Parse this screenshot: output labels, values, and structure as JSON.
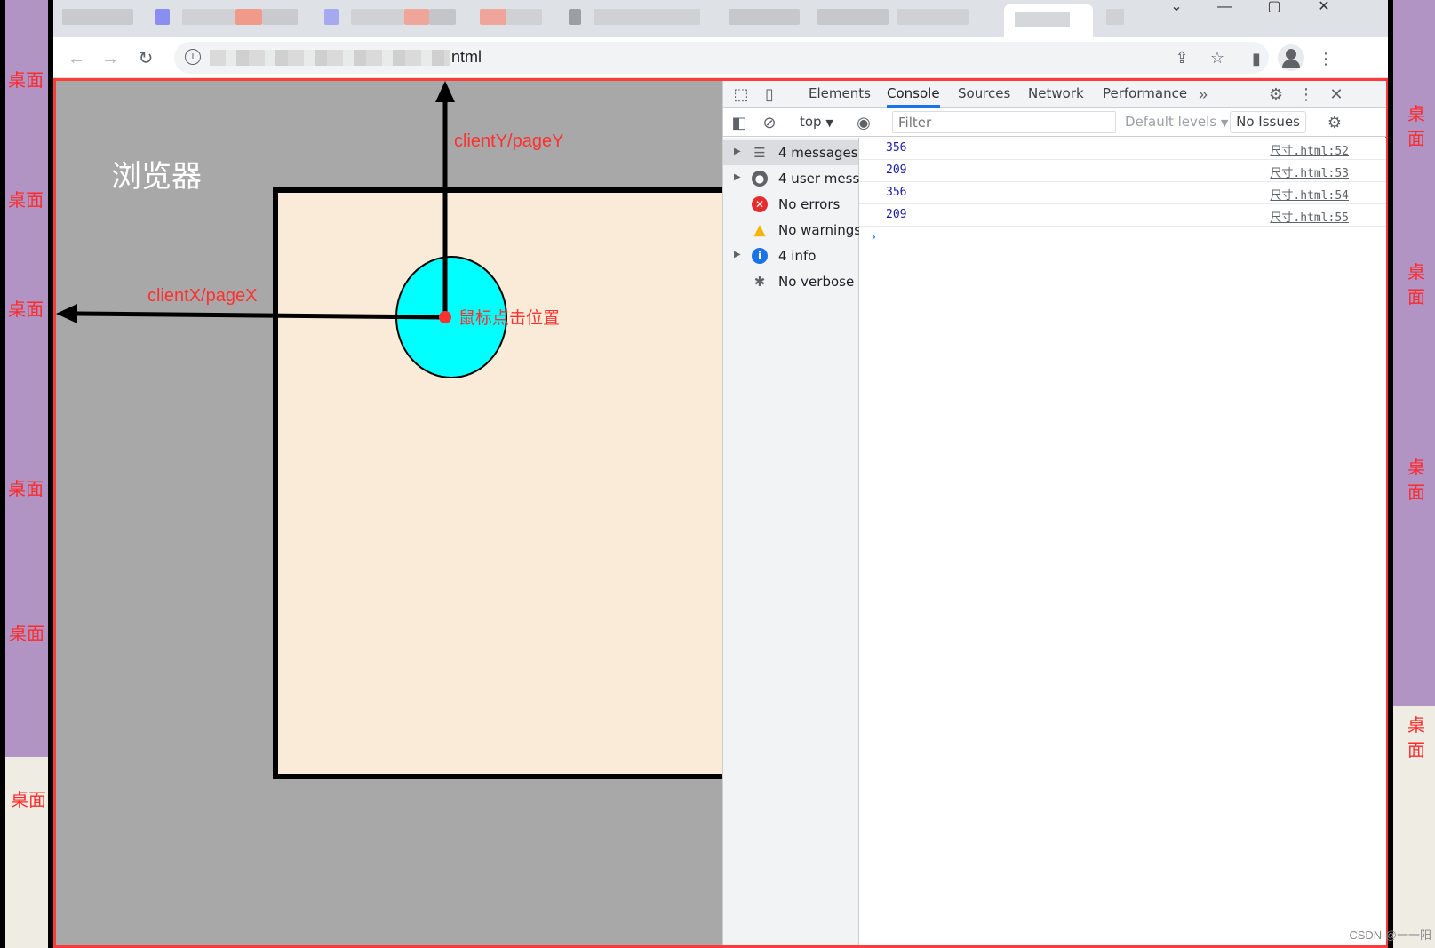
{
  "desktop": {
    "left_labels": [
      "桌面",
      "桌面",
      "桌面",
      "桌面",
      "桌面",
      "桌面"
    ],
    "right_labels": [
      "桌面",
      "桌面",
      "桌面",
      "桌面"
    ],
    "strip_color": "#b294c4"
  },
  "browser": {
    "url_suffix": "ntml",
    "window_controls": [
      "⌄",
      "—",
      "▢",
      "✕"
    ]
  },
  "diagram": {
    "browser_label": "浏览器",
    "client_y_label": "clientY/pageY",
    "client_x_label": "clientX/pageX",
    "click_label": "鼠标点击位置",
    "page_bg": "#a8a8a8",
    "box_bg": "#f9ebd7",
    "circle_color": "#00ffff",
    "accent": "#ff3030"
  },
  "devtools": {
    "tabs": [
      "Elements",
      "Console",
      "Sources",
      "Network",
      "Performance"
    ],
    "active_tab": "Console",
    "context": "top",
    "filter_placeholder": "Filter",
    "levels": "Default levels",
    "issues": "No Issues",
    "sidebar": [
      {
        "label": "4 messages",
        "icon": "list-icon",
        "expandable": true,
        "selected": true
      },
      {
        "label": "4 user mess...",
        "icon": "user-icon",
        "expandable": true,
        "selected": false
      },
      {
        "label": "No errors",
        "icon": "error-icon",
        "expandable": false,
        "selected": false
      },
      {
        "label": "No warnings",
        "icon": "warning-icon",
        "expandable": false,
        "selected": false
      },
      {
        "label": "4 info",
        "icon": "info-icon",
        "expandable": true,
        "selected": false
      },
      {
        "label": "No verbose",
        "icon": "bug-icon",
        "expandable": false,
        "selected": false
      }
    ],
    "logs": [
      {
        "value": "356",
        "source": "尺寸.html:52"
      },
      {
        "value": "209",
        "source": "尺寸.html:53"
      },
      {
        "value": "356",
        "source": "尺寸.html:54"
      },
      {
        "value": "209",
        "source": "尺寸.html:55"
      }
    ],
    "prompt": "›"
  },
  "watermark": "CSDN @一一阳"
}
